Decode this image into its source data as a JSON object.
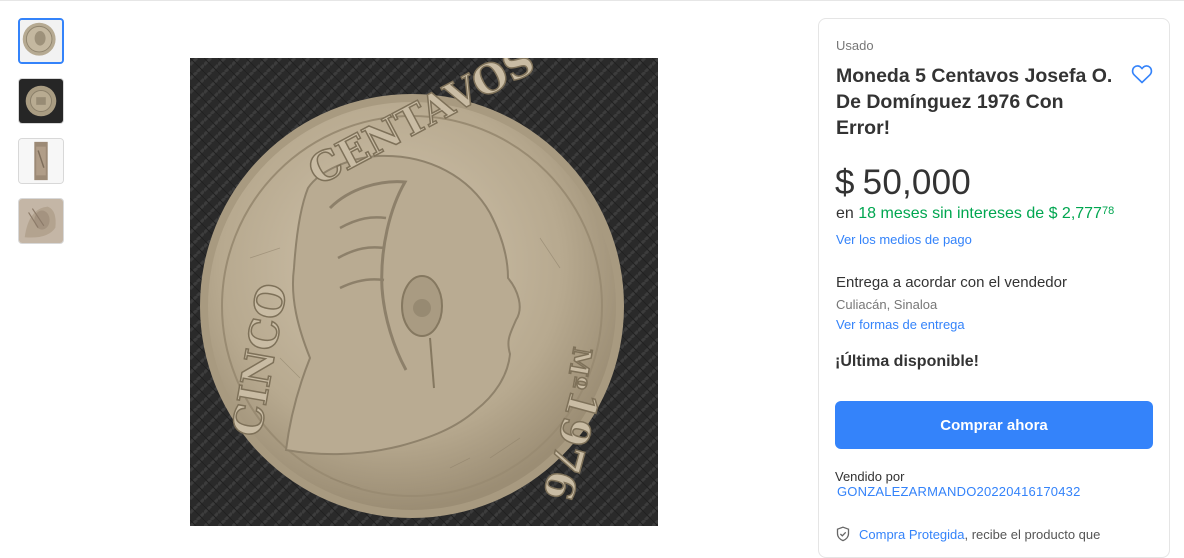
{
  "gallery": {
    "thumbnails": [
      {
        "label": "coin-obverse-thumb",
        "active": true
      },
      {
        "label": "coin-reverse-thumb",
        "active": false
      },
      {
        "label": "coin-edge-thumb",
        "active": false
      },
      {
        "label": "coin-detail-thumb",
        "active": false
      }
    ],
    "main_image": {
      "top_text": "CENTAVOS",
      "left_text": "CINCO",
      "year": "1976",
      "mint_mark": "Mº"
    }
  },
  "product": {
    "condition": "Usado",
    "title": "Moneda 5 Centavos Josefa O. De Domínguez 1976 Con Error!",
    "favorite_icon": "heart-outline-icon"
  },
  "price": {
    "symbol": "$",
    "amount": "50,000",
    "installment_prefix": "en",
    "installment_text": "18 meses sin intereses de $ 2,777",
    "installment_cents": "78",
    "payment_link": "Ver los medios de pago"
  },
  "shipping": {
    "delivery": "Entrega a acordar con el vendedor",
    "location": "Culiacán, Sinaloa",
    "link": "Ver formas de entrega"
  },
  "stock": {
    "label": "¡Última disponible!"
  },
  "actions": {
    "buy_now": "Comprar ahora"
  },
  "seller": {
    "label": "Vendido por",
    "name": "GONZALEZARMANDO20220416170432"
  },
  "protection": {
    "link": "Compra Protegida",
    "text": ", recibe el producto que",
    "icon": "shield-check-icon"
  },
  "colors": {
    "accent": "#3483fa",
    "green": "#00a650",
    "text": "#333333"
  }
}
